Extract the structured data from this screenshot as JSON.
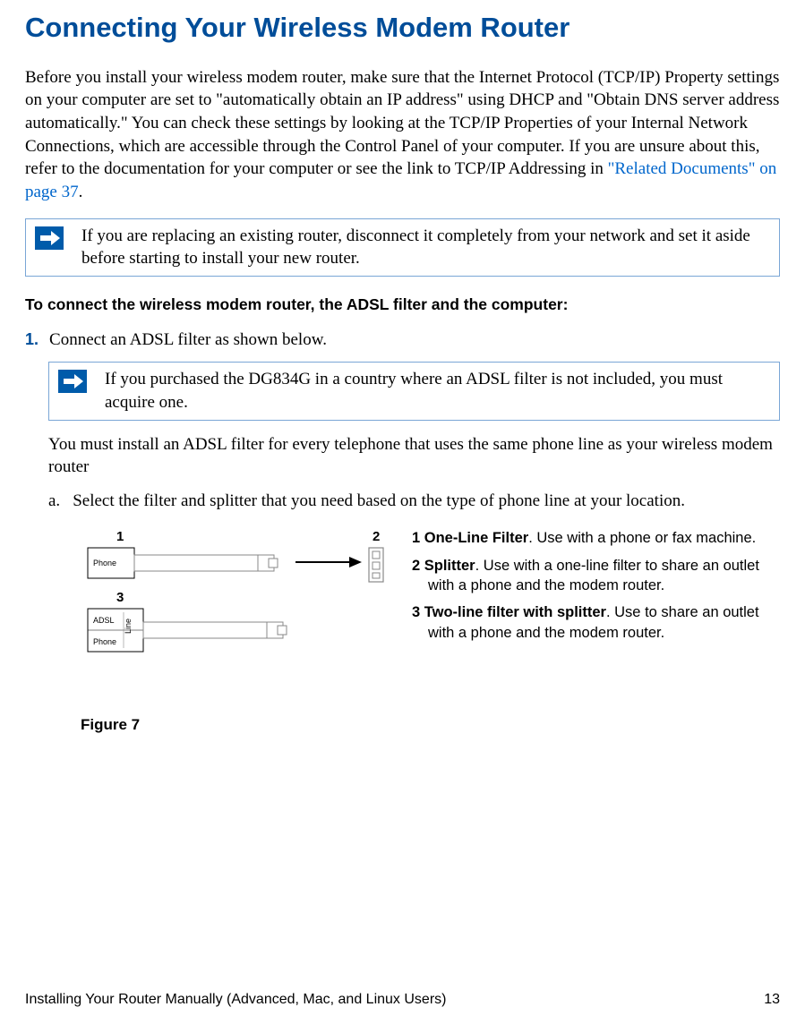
{
  "heading": "Connecting Your Wireless Modem Router",
  "intro_before_link": "Before you install your wireless modem router, make sure that the Internet Protocol (TCP/IP) Property settings on your computer are set to \"automatically obtain an IP address\" using DHCP and \"Obtain DNS server address automatically.\" You can check these settings by looking at the TCP/IP Properties of your Internal Network Connections, which are accessible through the Control Panel of your computer. If you are unsure about this, refer to the documentation for your computer or see the link to TCP/IP Addressing in  ",
  "intro_link": "\"Related Documents\" on page 37",
  "intro_after_link": ".",
  "note1": "If you are replacing an existing router, disconnect it completely from your network and set it aside before starting to install your new router.",
  "subheading": "To connect the wireless modem router, the ADSL filter and the computer:",
  "step1_num": "1.",
  "step1_text": "Connect an ADSL filter as shown below.",
  "note2": "If you purchased the DG834G in a country where an ADSL filter is not included, you must acquire one.",
  "post_note2_para": "You must install an ADSL filter for every telephone that uses the same phone line as your wireless modem router",
  "substep_a_label": "a.",
  "substep_a_text": "Select the filter and splitter that you need based on the type of phone line at your location.",
  "diagram": {
    "label_1": "1",
    "label_2": "2",
    "label_3": "3",
    "phone": "Phone",
    "adsl": "ADSL",
    "line": "Line"
  },
  "legend": {
    "l1_bold": "1 One-Line Filter",
    "l1_rest": ". Use with a phone or fax machine.",
    "l2_bold": "2 Splitter",
    "l2_rest": ". Use with a one-line filter to share an outlet",
    "l2_cont": "with a phone and the modem router.",
    "l3_bold": "3 Two-line filter with splitter",
    "l3_rest": ". Use to share an outlet",
    "l3_cont": "with a phone and the modem router."
  },
  "figure_caption": "Figure 7",
  "footer_left": "Installing Your Router Manually (Advanced, Mac, and Linux Users)",
  "footer_right": "13"
}
